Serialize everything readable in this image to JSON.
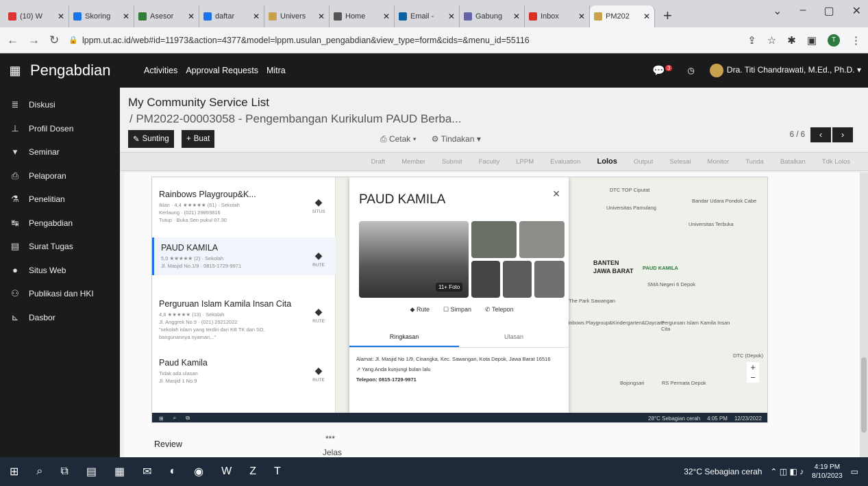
{
  "browser": {
    "tabs": [
      {
        "label": "(10) W",
        "color": "#d33"
      },
      {
        "label": "Skoring",
        "color": "#1a73e8"
      },
      {
        "label": "Asesor",
        "color": "#2e7d32"
      },
      {
        "label": "daftar",
        "color": "#1a73e8"
      },
      {
        "label": "Univers",
        "color": "#c9a24f"
      },
      {
        "label": "Home",
        "color": "#555"
      },
      {
        "label": "Email -",
        "color": "#0a64a4"
      },
      {
        "label": "Gabung",
        "color": "#6264a7"
      },
      {
        "label": "Inbox",
        "color": "#d93025"
      },
      {
        "label": "PM202",
        "color": "#c9a24f"
      }
    ],
    "new_tab": "+",
    "url": "lppm.ut.ac.id/web#id=11973&action=4377&model=lppm.usulan_pengabdian&view_type=form&cids=&menu_id=55116"
  },
  "appnav": {
    "brand": "Pengabdian",
    "menu": [
      "Activities",
      "Approval Requests",
      "Mitra"
    ],
    "chat_count": "3",
    "user": "Dra. Titi Chandrawati, M.Ed., Ph.D."
  },
  "sidebar": {
    "items": [
      {
        "label": "Diskusi",
        "icon": "≣"
      },
      {
        "label": "Profil Dosen",
        "icon": "⊥"
      },
      {
        "label": "Seminar",
        "icon": "▾"
      },
      {
        "label": "Pelaporan",
        "icon": "⎙"
      },
      {
        "label": "Penelitian",
        "icon": "⚗"
      },
      {
        "label": "Pengabdian",
        "icon": "↹"
      },
      {
        "label": "Surat Tugas",
        "icon": "▤"
      },
      {
        "label": "Situs Web",
        "icon": "●"
      },
      {
        "label": "Publikasi dan HKI",
        "icon": "⚇"
      },
      {
        "label": "Dasbor",
        "icon": "⊾"
      }
    ]
  },
  "main": {
    "breadcrumb_parent": "My Community Service List",
    "breadcrumb_current": "/ PM2022-00003058 - Pengembangan Kurikulum PAUD Berba...",
    "edit_label": "Sunting",
    "create_label": "Buat",
    "print_label": "Cetak",
    "action_label": "Tindakan",
    "pager": "6 / 6",
    "stages": [
      "Draft",
      "Member",
      "Submit",
      "Faculty",
      "LPPM",
      "Evaluation",
      "Lolos",
      "Output",
      "Selesai",
      "Monitor",
      "Tunda",
      "Batalkan",
      "Tdk Lolos"
    ],
    "current_stage": "Lolos",
    "review_label": "Review",
    "review_stars": "***",
    "review_text": "Jelas"
  },
  "embedded": {
    "places": [
      {
        "name": "Rainbows Playgroup&K...",
        "l1": "Iklan · 4,4 ★★★★★ (61) · Sekolah",
        "l2": "Kerlaung · (021) 29893816",
        "l3": "Tutup · Buka Sen pukul 07.30",
        "side": "SITUS"
      },
      {
        "name": "PAUD KAMILA",
        "l1": "5,0 ★★★★★ (2) · Sekolah",
        "l2": "Jl. Masjid No.1/9 · 0815-1729-9971",
        "l3": "",
        "side": "RUTE"
      },
      {
        "name": "Perguruan Islam Kamila Insan Cita",
        "l1": "4,8 ★★★★★ (13) · Sekolah",
        "l2": "Jl. Anggrek No.9 · (021) 29212022",
        "l3": "\"sekolah islam yang terdiri dari KB TK dan SD, bangunannya nyaman...\"",
        "side": "RUTE"
      },
      {
        "name": "Paud Kamila",
        "l1": "Tidak ada ulasan",
        "l2": "Jl. Masjid 1 No.9",
        "l3": "",
        "side": "RUTE"
      }
    ],
    "card": {
      "title": "PAUD KAMILA",
      "photo_count": "11+ Foto",
      "rute": "Rute",
      "simpan": "Simpan",
      "telepon": "Telepon",
      "tab_summary": "Ringkasan",
      "tab_reviews": "Ulasan",
      "address": "Alamat: Jl. Masjid No 1/9, Cinangka, Kec. Sawangan, Kota Depok, Jawa Barat 16516",
      "visited": "Yang Anda kunjungi bulan lalu",
      "phone": "Telepon: 0815-1729-9971"
    },
    "map_labels": [
      "Universitas Pamulang",
      "DTC TOP Ciputat",
      "Bandar Udara Pondok Cabe",
      "Universitas Terbuka",
      "BANTEN",
      "JAWA BARAT",
      "PAUD KAMILA",
      "SMA Negeri 6 Depok",
      "The Park Sawangan",
      "Rainbows Playgroup&Kindergarten&Daycare",
      "Perguruan Islam Kamila Insan Cita",
      "Bojongsari",
      "RS Permata Depok",
      "DTC (Depok)"
    ],
    "weather": "28°C Sebagian cerah",
    "time": "4:05 PM",
    "date": "12/23/2022"
  },
  "taskbar": {
    "weather": "32°C  Sebagian cerah",
    "time": "4:19 PM",
    "date": "8/10/2023"
  }
}
